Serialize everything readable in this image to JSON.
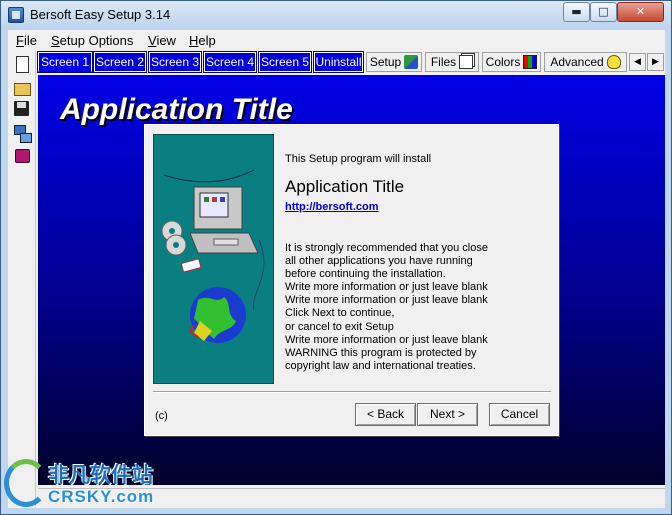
{
  "window": {
    "title": "Bersoft Easy Setup 3.14",
    "controls": {
      "minimize": "▬",
      "maximize": "□",
      "close": "✕"
    }
  },
  "menu": {
    "file": {
      "mnemonic": "F",
      "rest": "ile"
    },
    "setup_options": {
      "mnemonic": "S",
      "rest": "etup Options"
    },
    "view": {
      "mnemonic": "V",
      "rest": "iew"
    },
    "help": {
      "mnemonic": "H",
      "rest": "elp"
    }
  },
  "toolbar": {
    "icons": [
      "new-document-icon",
      "open-folder-icon",
      "save-disk-icon",
      "network-icon",
      "chip-icon"
    ]
  },
  "tabs": {
    "screens": [
      "Screen 1",
      "Screen 2",
      "Screen 3",
      "Screen 4",
      "Screen 5",
      "Uninstall"
    ],
    "active": "Screen 1",
    "setup": "Setup",
    "files": "Files",
    "colors": "Colors",
    "advanced": "Advanced",
    "prev_arrow": "◀",
    "next_arrow": "▶"
  },
  "preview": {
    "title": "Application Title",
    "background_top": "#0000e6",
    "background_bottom": "#00002a"
  },
  "dialog": {
    "intro": "This Setup program will install",
    "app_title": "Application Title",
    "link": "http://bersoft.com",
    "body": "It is strongly recommended that you close\nall other applications you have running\nbefore continuing the installation.\nWrite more information or just leave blank\nWrite more information or just leave blank\nClick Next to continue,\nor cancel to exit Setup\nWrite more information or just leave blank\nWARNING this program is protected by\ncopyright law and international treaties.",
    "copyright": "(c)",
    "back_button": "< Back",
    "next_button": "Next >",
    "cancel_button": "Cancel",
    "graphic_bg": "#0a7f82"
  },
  "watermark": {
    "chinese": "非凡软件站",
    "english": "CRSKY.com"
  }
}
